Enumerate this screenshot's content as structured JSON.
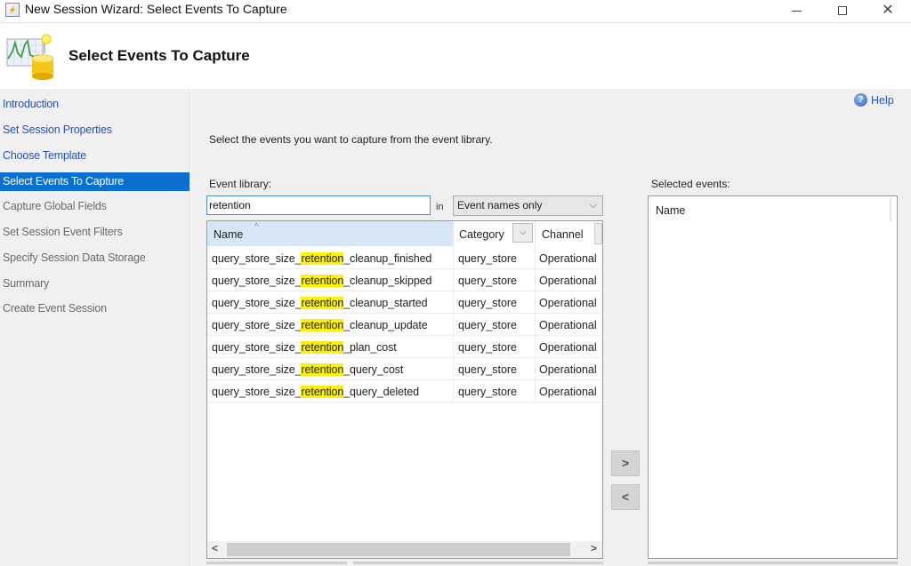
{
  "window": {
    "title": "New Session Wizard: Select Events To Capture"
  },
  "header": {
    "title": "Select Events To Capture"
  },
  "sidebar": {
    "items": [
      {
        "label": "Introduction",
        "state": "done"
      },
      {
        "label": "Set Session Properties",
        "state": "done"
      },
      {
        "label": "Choose Template",
        "state": "done"
      },
      {
        "label": "Select Events To Capture",
        "state": "active"
      },
      {
        "label": "Capture Global Fields",
        "state": "pending"
      },
      {
        "label": "Set Session Event Filters",
        "state": "pending"
      },
      {
        "label": "Specify Session Data Storage",
        "state": "pending"
      },
      {
        "label": "Summary",
        "state": "pending"
      },
      {
        "label": "Create Event Session",
        "state": "pending"
      }
    ]
  },
  "main": {
    "help_label": "Help",
    "intro_text": "Select the events you want to capture from the event library.",
    "event_library_label": "Event library:",
    "search_value": "retention",
    "in_label": "in",
    "search_scope": "Event names only",
    "highlight_term": "retention",
    "columns": {
      "name": "Name",
      "category": "Category",
      "channel": "Channel"
    },
    "events": [
      {
        "prefix": "query_store_size_",
        "match": "retention",
        "suffix": "_cleanup_finished",
        "category": "query_store",
        "channel": "Operational"
      },
      {
        "prefix": "query_store_size_",
        "match": "retention",
        "suffix": "_cleanup_skipped",
        "category": "query_store",
        "channel": "Operational"
      },
      {
        "prefix": "query_store_size_",
        "match": "retention",
        "suffix": "_cleanup_started",
        "category": "query_store",
        "channel": "Operational"
      },
      {
        "prefix": "query_store_size_",
        "match": "retention",
        "suffix": "_cleanup_update",
        "category": "query_store",
        "channel": "Operational"
      },
      {
        "prefix": "query_store_size_",
        "match": "retention",
        "suffix": "_plan_cost",
        "category": "query_store",
        "channel": "Operational"
      },
      {
        "prefix": "query_store_size_",
        "match": "retention",
        "suffix": "_query_cost",
        "category": "query_store",
        "channel": "Operational"
      },
      {
        "prefix": "query_store_size_",
        "match": "retention",
        "suffix": "_query_deleted",
        "category": "query_store",
        "channel": "Operational"
      }
    ],
    "add_button": ">",
    "remove_button": "<",
    "selected_events_label": "Selected events:",
    "selected_columns": {
      "name": "Name"
    },
    "selected_events": []
  },
  "icons": {
    "help": "?",
    "sort_ascending": "^",
    "filter_dropdown": "⌄",
    "scroll_left": "<",
    "scroll_right": ">"
  },
  "colors": {
    "active_nav": "#0b6fd1",
    "done_nav": "#2752b8",
    "highlight": "#fff200",
    "selected_header": "#d8e7f6"
  }
}
